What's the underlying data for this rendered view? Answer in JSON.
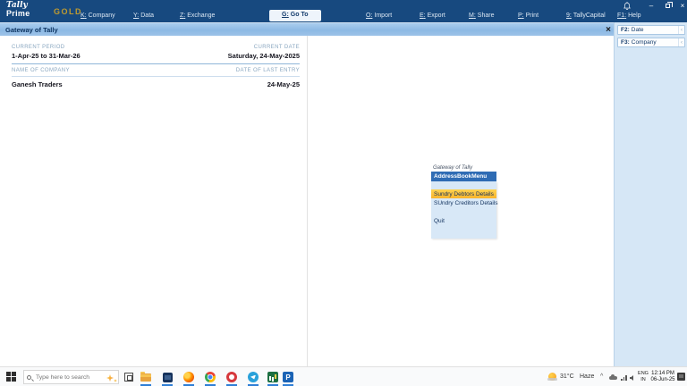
{
  "topbar": {
    "logo": {
      "script": "Tally",
      "name": "Prime",
      "edition": "GOLD"
    },
    "menu": [
      {
        "key": "K",
        "label": "Company"
      },
      {
        "key": "Y",
        "label": "Data"
      },
      {
        "key": "Z",
        "label": "Exchange"
      },
      {
        "key": "G",
        "label": "Go To"
      },
      {
        "key": "O",
        "label": "Import"
      },
      {
        "key": "E",
        "label": "Export"
      },
      {
        "key": "M",
        "label": "Share"
      },
      {
        "key": "P",
        "label": "Print"
      },
      {
        "key": "9",
        "label": "TallyCapital"
      },
      {
        "key": "F1",
        "label": "Help"
      }
    ],
    "controls": {
      "minimize": "–",
      "close": "×"
    }
  },
  "titlebar": {
    "title": "Gateway of Tally",
    "close": "×"
  },
  "info_panel": {
    "current_period_label": "CURRENT PERIOD",
    "current_period": "1-Apr-25 to 31-Mar-26",
    "current_date_label": "CURRENT DATE",
    "current_date": "Saturday, 24-May-2025",
    "company_label": "NAME OF COMPANY",
    "company": "Ganesh Traders",
    "last_entry_label": "DATE OF LAST ENTRY",
    "last_entry": "24-May-25"
  },
  "gateway_menu": {
    "caption": "Gateway of Tally",
    "header": "AddressBookMenu",
    "items": [
      {
        "label": "Sundry Debtors Details"
      },
      {
        "label": "SUndry Creditors Details"
      },
      {
        "label": "Quit"
      }
    ]
  },
  "right_panel": {
    "buttons": [
      {
        "key": "F2",
        "label": "Date",
        "arrow": "‹"
      },
      {
        "key": "F3",
        "label": "Company",
        "arrow": "‹"
      }
    ]
  },
  "taskbar": {
    "search_placeholder": "Type here to search",
    "apps": [
      "file-explorer",
      "dark-app",
      "firefox",
      "chrome",
      "opera",
      "telegram",
      "excel",
      "tally-prime"
    ],
    "prime_glyph": "P",
    "tray": {
      "temperature": "31°C",
      "condition": "Haze",
      "expand": "^",
      "lang_line1": "ENG",
      "lang_line2": "IN",
      "time": "12:14 PM",
      "date": "06-Jun-25"
    }
  },
  "colors": {
    "topbar": "#17497f",
    "titlebar": "#8db9e4",
    "menu_header": "#2f6cb4",
    "menu_body": "#d8e8f7",
    "highlight": "#ffc63c",
    "right_panel": "#d6e7f6",
    "running_indicator": "#2f7fd6"
  }
}
